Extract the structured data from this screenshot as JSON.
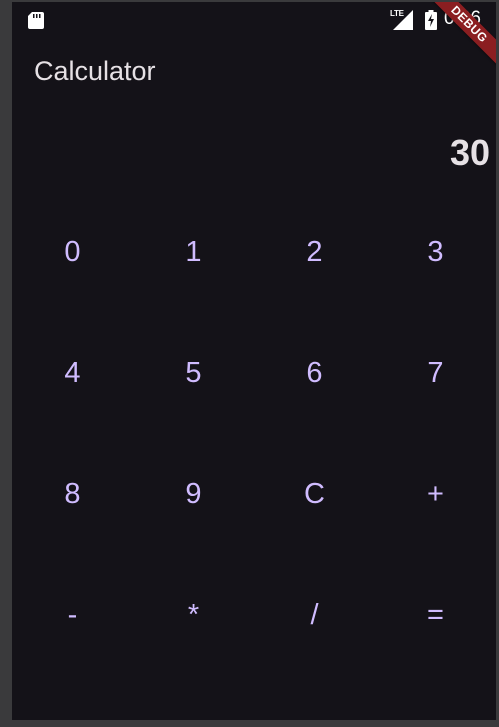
{
  "status_bar": {
    "sd_icon": "sd-card-icon",
    "network_label": "LTE",
    "signal_icon": "cell-signal-icon",
    "battery_icon": "battery-charging-icon",
    "time": "0:06",
    "debug_banner": "DEBUG"
  },
  "app": {
    "title": "Calculator"
  },
  "display": {
    "value": "30"
  },
  "keypad": {
    "keys": [
      "0",
      "1",
      "2",
      "3",
      "4",
      "5",
      "6",
      "7",
      "8",
      "9",
      "C",
      "+",
      "-",
      "*",
      "/",
      "="
    ]
  },
  "colors": {
    "background": "#141218",
    "key_text": "#d0bcff",
    "title_text": "#e6e1e5",
    "debug_banner": "#8b1e21"
  }
}
